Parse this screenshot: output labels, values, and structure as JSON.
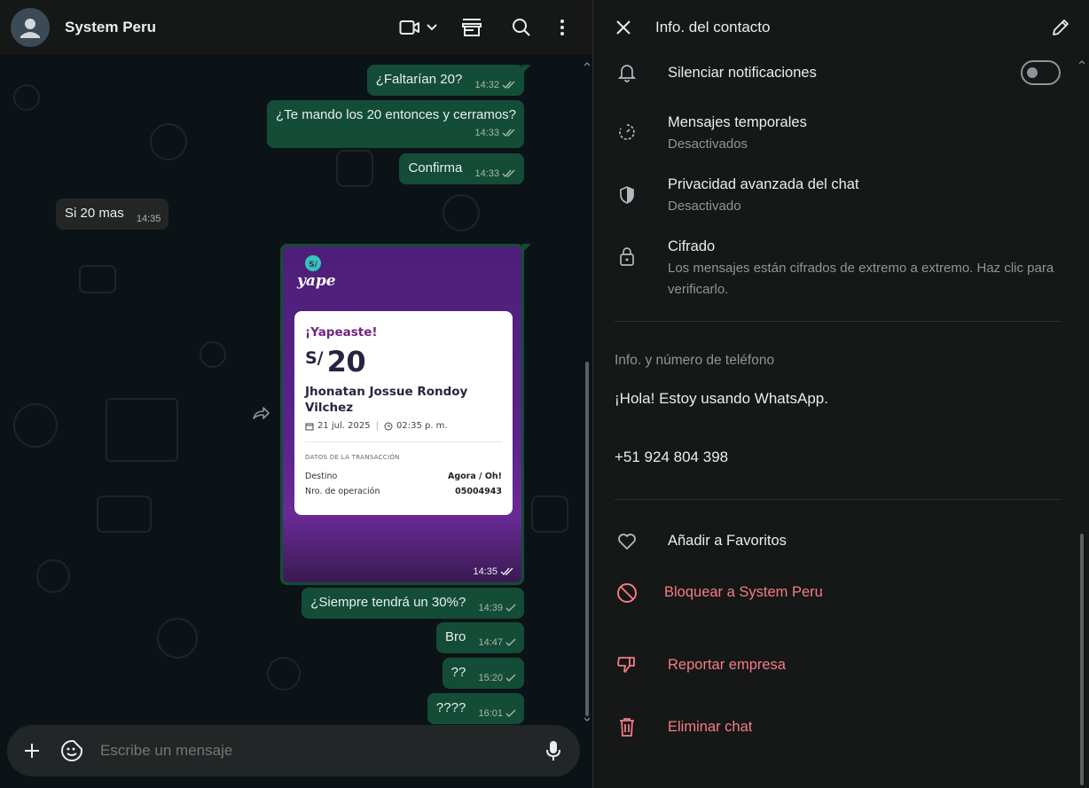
{
  "chat": {
    "name": "System Peru",
    "messages": [
      {
        "text": "¿Faltarían 20?",
        "time": "14:32",
        "status": "read"
      },
      {
        "text": "¿Te mando los 20 entonces y cerramos?",
        "time": "14:33",
        "status": "read"
      },
      {
        "text": "Confirma",
        "time": "14:33",
        "status": "read"
      },
      {
        "text": "Si 20 mas",
        "time": "14:35",
        "status": "incoming"
      },
      {
        "text": "¿Siempre tendrá un 30%?",
        "time": "14:39",
        "status": "sent"
      },
      {
        "text": "Bro",
        "time": "14:47",
        "status": "sent"
      },
      {
        "text": "??",
        "time": "15:20",
        "status": "sent"
      },
      {
        "text": "????",
        "time": "16:01",
        "status": "sent"
      }
    ],
    "image_message": {
      "time": "14:35",
      "status": "read",
      "logo_badge": "S/",
      "logo_text": "yape",
      "title": "¡Yapeaste!",
      "currency": "S/",
      "amount": "20",
      "recipient": "Jhonatan Jossue Rondoy Vilchez",
      "date": "21 jul. 2025",
      "time_label": "02:35 p. m.",
      "section": "DATOS DE LA TRANSACCIÓN",
      "destino_label": "Destino",
      "destino_value": "Agora / Oh!",
      "op_label": "Nro. de operación",
      "op_value": "05004943"
    },
    "composer_placeholder": "Escribe un mensaje"
  },
  "info": {
    "title": "Info. del contacto",
    "mute_label": "Silenciar notificaciones",
    "temp_label": "Mensajes temporales",
    "temp_value": "Desactivados",
    "privacy_label": "Privacidad avanzada del chat",
    "privacy_value": "Desactivado",
    "encryption_label": "Cifrado",
    "encryption_desc": "Los mensajes están cifrados de extremo a extremo. Haz clic para verificarlo.",
    "phone_section": "Info. y número de teléfono",
    "about": "¡Hola! Estoy usando WhatsApp.",
    "phone": "+51 924 804 398",
    "favorite": "Añadir a Favoritos",
    "block": "Bloquear a System Peru",
    "report": "Reportar empresa",
    "delete": "Eliminar chat"
  },
  "colors": {
    "outgoing_bubble": "#144d37",
    "incoming_bubble": "#242626",
    "danger": "#f47c86",
    "yape_purple": "#742284"
  }
}
